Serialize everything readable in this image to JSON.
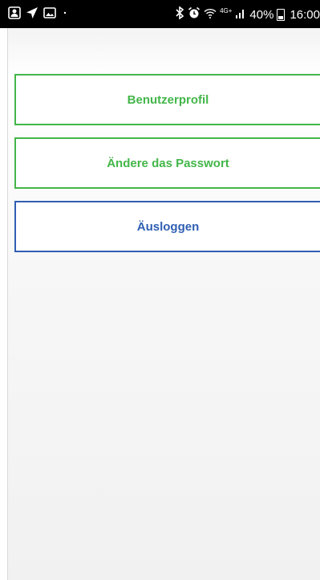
{
  "status_bar": {
    "left_icons": [
      "profile-icon",
      "navigation-icon",
      "gallery-icon",
      "dot-icon"
    ],
    "right_icons": [
      "bluetooth-icon",
      "alarm-icon",
      "wifi-icon",
      "signal-icon",
      "battery-icon"
    ],
    "network": "4G+",
    "battery_percent": "40%",
    "time": "16:00"
  },
  "menu": {
    "profile_label": "Benutzerprofil",
    "password_label": "Ändere das Passwort",
    "logout_label": "Äusloggen"
  },
  "colors": {
    "green": "#43b649",
    "blue": "#2f5fb3"
  }
}
